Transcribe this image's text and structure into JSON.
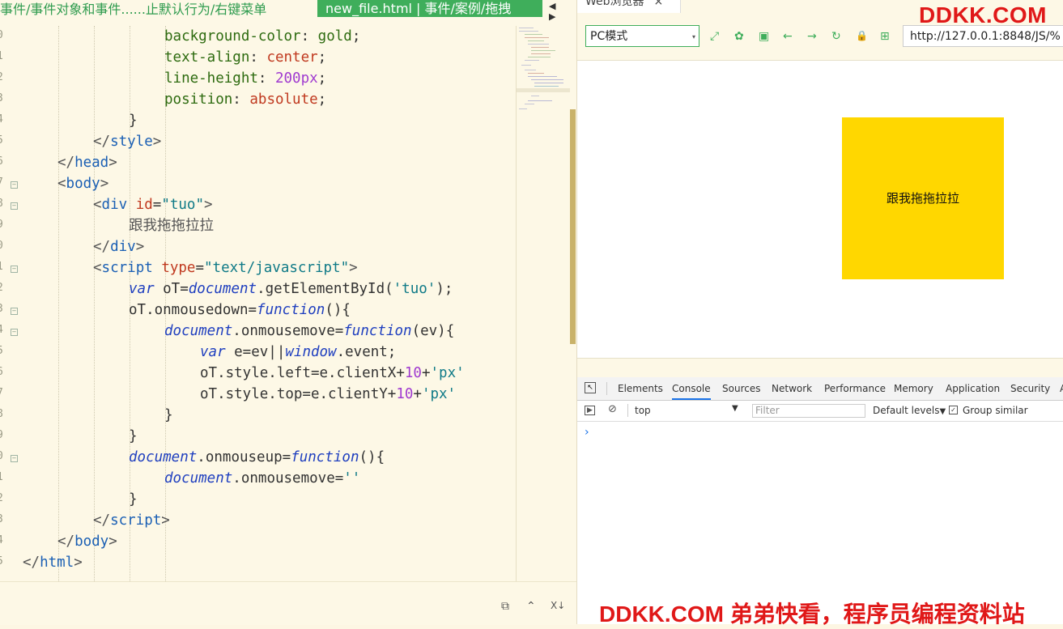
{
  "editor": {
    "breadcrumb": "事件/事件对象和事件......止默认行为/右键菜单",
    "active_tab": "new_file.html | 事件/案例/拖拽",
    "tab_arrows": "◀ ▶",
    "line_numbers": [
      "0",
      "1",
      "2",
      "3",
      "4",
      "5",
      "6",
      "7",
      "8",
      "9",
      "0",
      "1",
      "2",
      "3",
      "4",
      "5",
      "6",
      "7",
      "8",
      "9",
      "0",
      "1",
      "2",
      "3",
      "4",
      "5"
    ],
    "code": {
      "l0a": "background-color",
      "l0b": ": ",
      "l0c": "gold",
      "l0d": ";",
      "l1a": "text-align",
      "l1b": ": ",
      "l1c": "center",
      "l1d": ";",
      "l2a": "line-height",
      "l2b": ": ",
      "l2c": "200px",
      "l2d": ";",
      "l3a": "position",
      "l3b": ": ",
      "l3c": "absolute",
      "l3d": ";",
      "l4": "}",
      "l5a": "</",
      "l5b": "style",
      "l5c": ">",
      "l6a": "</",
      "l6b": "head",
      "l6c": ">",
      "l7a": "<",
      "l7b": "body",
      "l7c": ">",
      "l8a": "<",
      "l8b": "div",
      "l8c": "id",
      "l8d": "=",
      "l8e": "\"tuo\"",
      "l8f": ">",
      "l9": "跟我拖拖拉拉",
      "l10a": "</",
      "l10b": "div",
      "l10c": ">",
      "l11a": "<",
      "l11b": "script",
      "l11c": "type",
      "l11d": "=",
      "l11e": "\"text/javascript\"",
      "l11f": ">",
      "l12a": "var",
      "l12b": " oT=",
      "l12c": "document",
      "l12d": ".getElementById(",
      "l12e": "'tuo'",
      "l12f": ");",
      "l13a": "oT.onmousedown=",
      "l13b": "function",
      "l13c": "(){",
      "l14a": "document",
      "l14b": ".onmousemove=",
      "l14c": "function",
      "l14d": "(ev){",
      "l15a": "var",
      "l15b": " e=ev||",
      "l15c": "window",
      "l15d": ".event;",
      "l16a": "oT.style.left=e.clientX+",
      "l16b": "10",
      "l16c": "+",
      "l16d": "'px'",
      "l17a": "oT.style.top=e.clientY+",
      "l17b": "10",
      "l17c": "+",
      "l17d": "'px'",
      "l18": "}",
      "l19": "}",
      "l20a": "document",
      "l20b": ".onmouseup=",
      "l20c": "function",
      "l20d": "(){",
      "l21a": "document",
      "l21b": ".onmousemove=",
      "l21c": "''",
      "l22": "}",
      "l23a": "</",
      "l23b": "script",
      "l23c": ">",
      "l24a": "</",
      "l24b": "body",
      "l24c": ">",
      "l25a": "</",
      "l25b": "html",
      "l25c": ">"
    },
    "fold_marker": "−",
    "status_icons": [
      "⧉",
      "⌃",
      "X↓"
    ]
  },
  "browser": {
    "tab_title": "Web浏览器",
    "tab_close": "×",
    "mode": "PC模式",
    "mode_caret": "▾",
    "url": "http://127.0.0.1:8848/JS/%",
    "brand_top": "DDKK.COM",
    "box_text": "跟我拖拖拉拉",
    "nav_icons": [
      "⤢",
      "✿",
      "▣",
      "←",
      "→",
      "↻",
      "🔒",
      "⊞"
    ]
  },
  "devtools": {
    "tabs": [
      "Elements",
      "Console",
      "Sources",
      "Network",
      "Performance",
      "Memory",
      "Application",
      "Security",
      "A"
    ],
    "active_tab": "Console",
    "context": "top",
    "context_caret": "▼",
    "filter_placeholder": "Filter",
    "levels": "Default levels",
    "levels_caret": "▼",
    "group_similar": "Group similar",
    "checkbox_mark": "✓",
    "prompt": "›",
    "inspect_icon": "↖",
    "sidebar_icon": "▶",
    "clear_icon": "⊘"
  },
  "watermark_bottom": "DDKK.COM 弟弟快看，程序员编程资料站",
  "colors": {
    "accent_green": "#3fae5b",
    "brand_red": "#e01818",
    "gold": "#ffd700"
  }
}
